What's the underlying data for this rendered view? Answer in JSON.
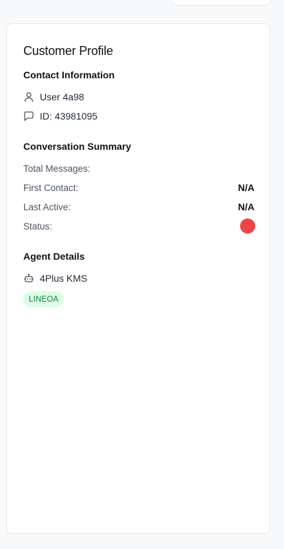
{
  "profile": {
    "title": "Customer Profile",
    "contact": {
      "heading": "Contact Information",
      "user_name": "User 4a98",
      "user_icon": "user-icon",
      "id_label": "ID: 43981095",
      "id_icon": "message-square-icon"
    },
    "summary": {
      "heading": "Conversation Summary",
      "total_messages_label": "Total Messages:",
      "total_messages_value": "",
      "first_contact_label": "First Contact:",
      "first_contact_value": "N/A",
      "last_active_label": "Last Active:",
      "last_active_value": "N/A",
      "status_label": "Status:",
      "status_color": "#ef4444"
    },
    "agent": {
      "heading": "Agent Details",
      "agent_name": "4Plus KMS",
      "agent_icon": "bot-icon",
      "channel_badge": "LINEOA",
      "badge_bg": "#dcfce7",
      "badge_text_color": "#15803d"
    }
  }
}
